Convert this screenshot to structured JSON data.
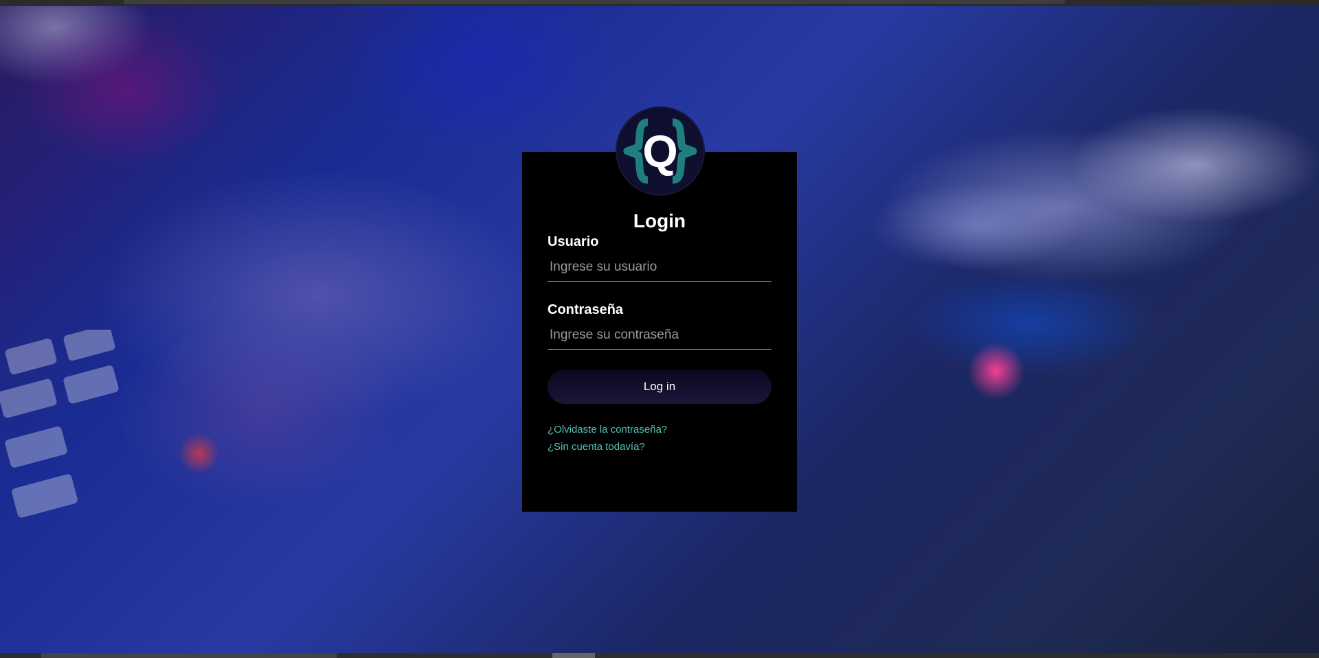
{
  "login": {
    "title": "Login",
    "username_label": "Usuario",
    "username_placeholder": "Ingrese su usuario",
    "username_value": "",
    "password_label": "Contraseña",
    "password_placeholder": "Ingrese su contraseña",
    "password_value": "",
    "submit_label": "Log in",
    "forgot_password_link": "¿Olvidaste la contraseña?",
    "signup_link": "¿Sin cuenta todavía?"
  },
  "logo": {
    "letter": "Q",
    "icon": "q-braces-logo-icon"
  },
  "colors": {
    "card_background": "#000000",
    "link": "#54c4b5",
    "logo_braces": "#1f7f7f",
    "button_gradient_start": "#0a0820",
    "button_gradient_end": "#1b1538"
  }
}
